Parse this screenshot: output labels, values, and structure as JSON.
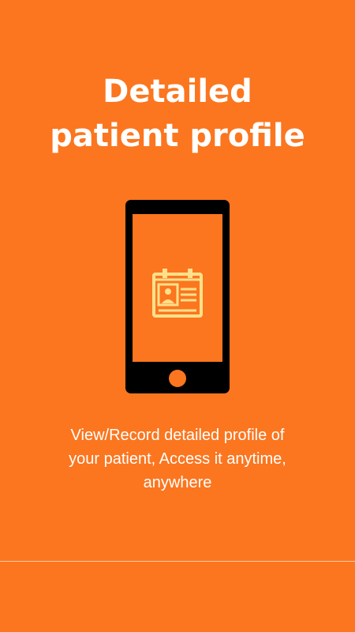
{
  "onboarding": {
    "title_line1": "Detailed",
    "title_line2": "patient profile",
    "description_line1": "View/Record detailed profile of",
    "description_line2": "your patient, Access it anytime,",
    "description_line3": "anywhere",
    "illustration_icon": "phone-with-patient-id-card-icon"
  },
  "colors": {
    "background": "#FB761F",
    "text": "#FFFFFF",
    "phone_frame": "#000000",
    "id_card_icon": "#FFE08A",
    "divider": "#FFC9A3"
  }
}
